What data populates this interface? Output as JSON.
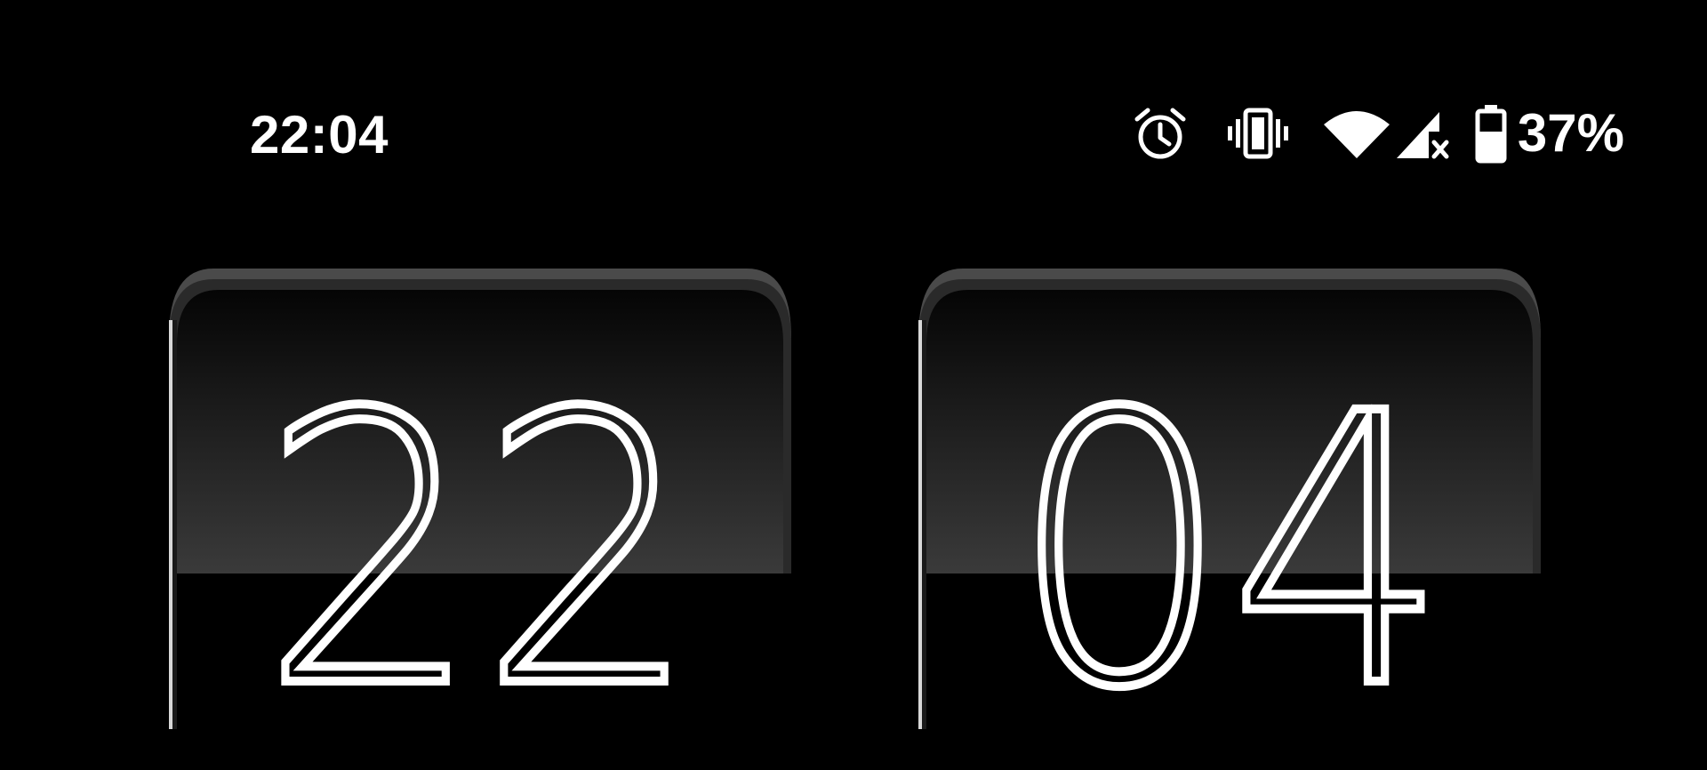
{
  "status_bar": {
    "time": "22:04",
    "icons": [
      "alarm-icon",
      "vibrate-icon",
      "wifi-icon",
      "signal-icon",
      "battery-icon"
    ],
    "battery_percent": "37%",
    "battery_level": 0.37
  },
  "clock": {
    "hours": "22",
    "minutes": "04"
  }
}
